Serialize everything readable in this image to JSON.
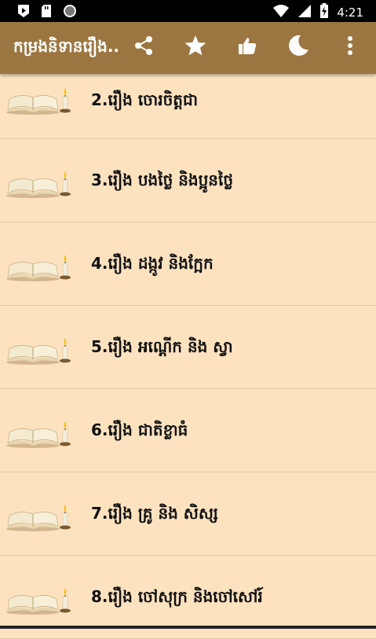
{
  "status_bar": {
    "time": "4:21",
    "icons": [
      "play-icon",
      "sd-card-icon",
      "circle-icon",
      "wifi-icon",
      "signal-icon",
      "battery-charging-icon"
    ]
  },
  "app_bar": {
    "title": "កម្រងនិទានរឿង..",
    "actions": [
      "share-icon",
      "star-icon",
      "thumbs-up-icon",
      "moon-icon",
      "more-vert-icon"
    ]
  },
  "colors": {
    "app_bar": "#9b7640",
    "background": "#fde2c0",
    "divider": "#e0c8a6"
  },
  "list": {
    "items": [
      {
        "label": "2.រឿង ចោរចិត្តជា",
        "icon": "open-book-candle-icon"
      },
      {
        "label": "3.រឿង បងថ្លៃ និងប្អូនថ្លៃ",
        "icon": "open-book-candle-icon"
      },
      {
        "label": "4.រឿង ដង្កូវ និងក្អែក",
        "icon": "open-book-candle-icon"
      },
      {
        "label": "5.រឿង អណ្តើក និង ស្វា",
        "icon": "open-book-candle-icon"
      },
      {
        "label": "6.រឿង ជាតិខ្លាធំ",
        "icon": "open-book-candle-icon"
      },
      {
        "label": "7.រឿង គ្រូ និង សិស្ស",
        "icon": "open-book-candle-icon"
      },
      {
        "label": "8.រឿង ចៅសុក្រ និងចៅសៅរ៍",
        "icon": "open-book-candle-icon"
      }
    ]
  }
}
